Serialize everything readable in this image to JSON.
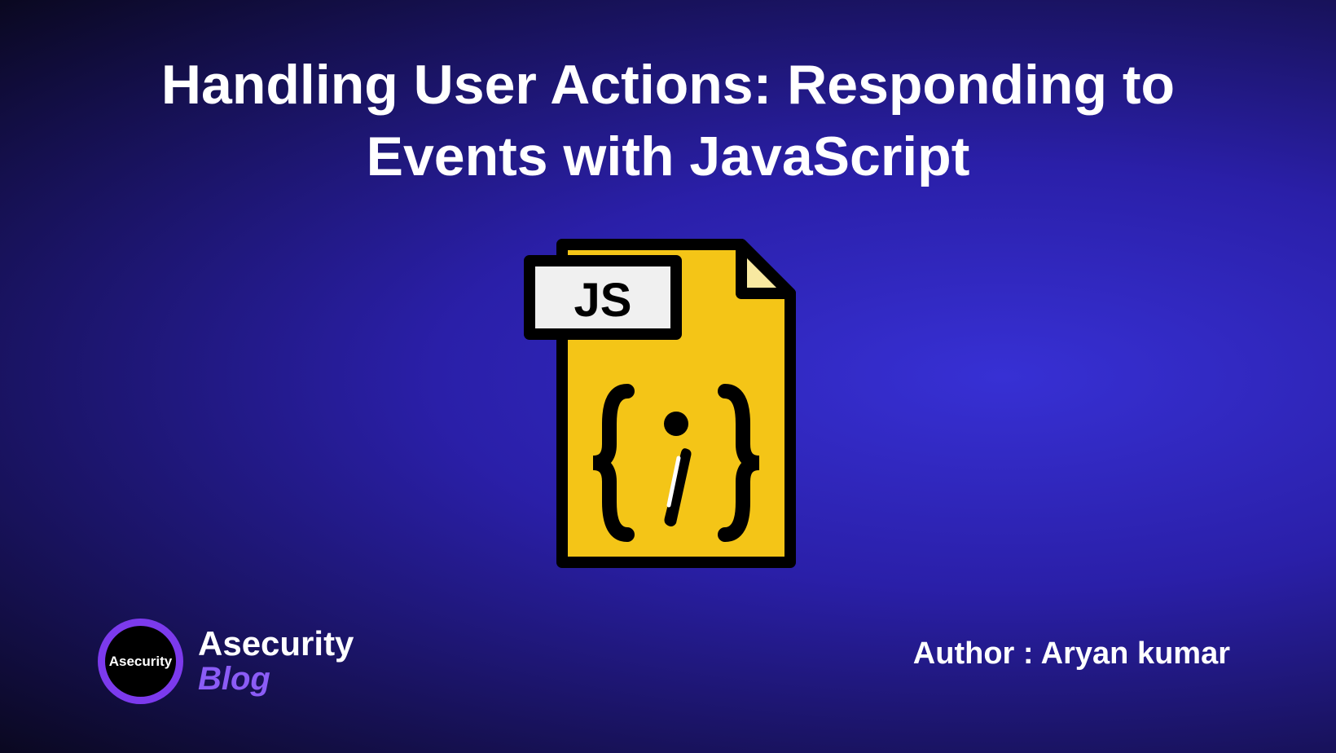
{
  "title": "Handling User Actions: Responding to Events with JavaScript",
  "icon": {
    "label": "JS",
    "glyph": "i"
  },
  "logo": {
    "badge": "Asecurity",
    "line1": "Asecurity",
    "line2": "Blog"
  },
  "author": "Author : Aryan kumar"
}
